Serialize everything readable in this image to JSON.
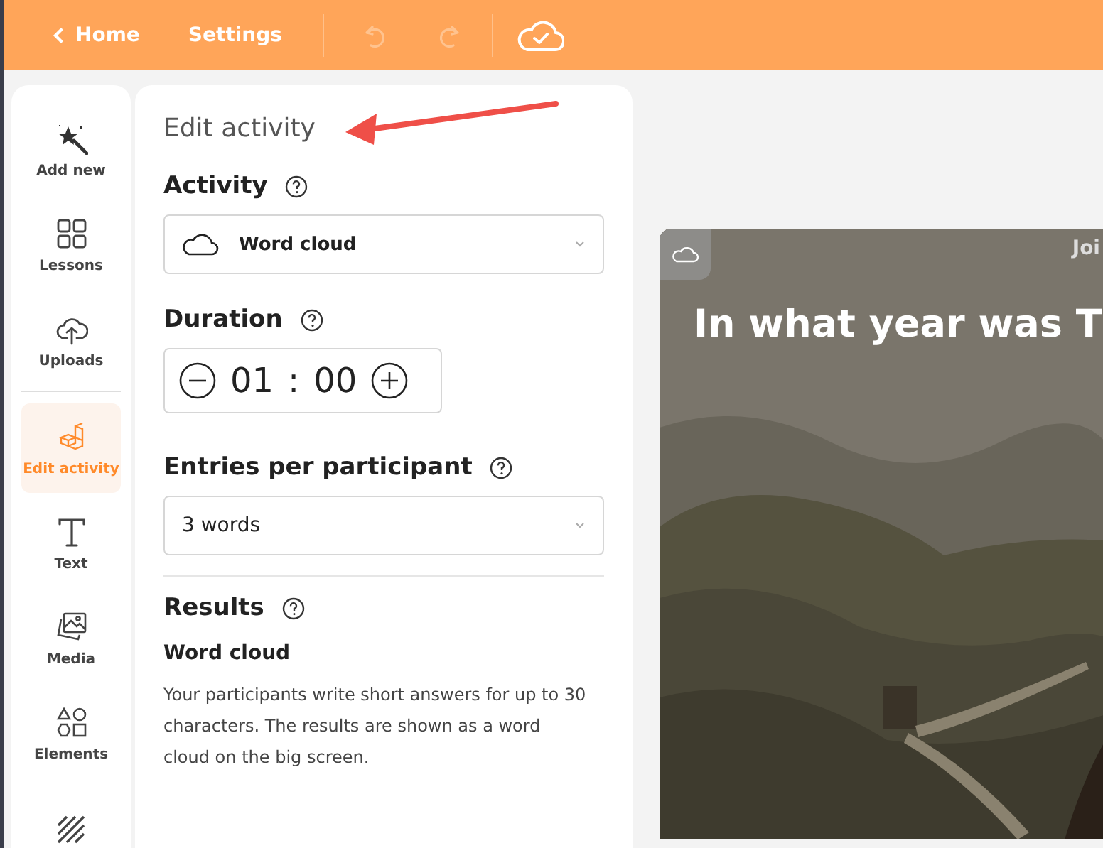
{
  "topbar": {
    "back": "Home",
    "settings": "Settings",
    "undo_disabled": true,
    "redo_disabled": true
  },
  "sidebar": {
    "items": [
      {
        "label": "Add new",
        "selected": false
      },
      {
        "label": "Lessons",
        "selected": false
      },
      {
        "label": "Uploads",
        "selected": false
      },
      {
        "label": "Edit activity",
        "selected": true
      },
      {
        "label": "Text",
        "selected": false
      },
      {
        "label": "Media",
        "selected": false
      },
      {
        "label": "Elements",
        "selected": false
      },
      {
        "selected": false
      }
    ]
  },
  "panel": {
    "title": "Edit activity",
    "activity": {
      "label": "Activity",
      "value": "Word cloud"
    },
    "duration": {
      "label": "Duration",
      "minutes": "01",
      "separator": ":",
      "seconds": "00"
    },
    "entries": {
      "label": "Entries per participant",
      "value": "3 words"
    },
    "results": {
      "label": "Results",
      "type": "Word cloud",
      "description": "Your participants write short answers for up to 30 characters. The results are shown as a word cloud on the big screen."
    }
  },
  "slide": {
    "kind": "picture",
    "join": "Joi",
    "question": "In what year was T"
  }
}
